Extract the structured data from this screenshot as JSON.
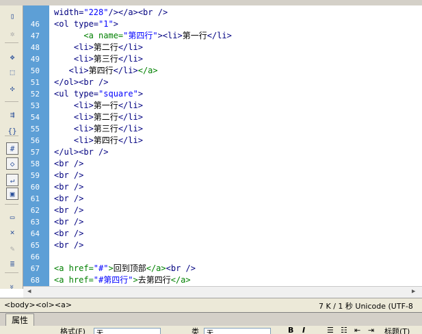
{
  "toolbar": {
    "icons": [
      "file-icon",
      "gear-icon",
      "expand-icon",
      "select-icon",
      "collapse-icon",
      "indent-icon",
      "braces-icon",
      "hash-icon",
      "code-icon",
      "wrap-icon",
      "highlight-icon",
      "comment-icon",
      "remove-comment-icon",
      "brush-icon",
      "format-icon",
      "more-icon"
    ]
  },
  "editor": {
    "lines": [
      {
        "n": "",
        "parts": [
          {
            "t": "width=",
            "c": "at"
          },
          {
            "t": "\"228\"",
            "c": "av"
          },
          {
            "t": "/></a><br />",
            "c": "kw"
          }
        ]
      },
      {
        "n": "46",
        "parts": [
          {
            "t": "<ol type=",
            "c": "kw"
          },
          {
            "t": "\"1\"",
            "c": "av"
          },
          {
            "t": ">",
            "c": "kw"
          }
        ]
      },
      {
        "n": "47",
        "parts": [
          {
            "t": "      <a name=",
            "c": "grn"
          },
          {
            "t": "\"第四行\"",
            "c": "av"
          },
          {
            "t": "><li>",
            "c": "kw"
          },
          {
            "t": "第一行",
            "c": "tx"
          },
          {
            "t": "</li>",
            "c": "kw"
          }
        ]
      },
      {
        "n": "48",
        "parts": [
          {
            "t": "    <li>",
            "c": "kw"
          },
          {
            "t": "第二行",
            "c": "tx"
          },
          {
            "t": "</li>",
            "c": "kw"
          }
        ]
      },
      {
        "n": "49",
        "parts": [
          {
            "t": "    <li>",
            "c": "kw"
          },
          {
            "t": "第三行",
            "c": "tx"
          },
          {
            "t": "</li>",
            "c": "kw"
          }
        ]
      },
      {
        "n": "50",
        "parts": [
          {
            "t": "   <li>",
            "c": "kw"
          },
          {
            "t": "第四行",
            "c": "tx"
          },
          {
            "t": "</li>",
            "c": "kw"
          },
          {
            "t": "</a>",
            "c": "grn"
          }
        ]
      },
      {
        "n": "51",
        "parts": [
          {
            "t": "</ol><br />",
            "c": "kw"
          }
        ]
      },
      {
        "n": "52",
        "parts": [
          {
            "t": "<ul type=",
            "c": "kw"
          },
          {
            "t": "\"square\"",
            "c": "av"
          },
          {
            "t": ">",
            "c": "kw"
          }
        ]
      },
      {
        "n": "53",
        "parts": [
          {
            "t": "    <li>",
            "c": "kw"
          },
          {
            "t": "第一行",
            "c": "tx"
          },
          {
            "t": "</li>",
            "c": "kw"
          }
        ]
      },
      {
        "n": "54",
        "parts": [
          {
            "t": "    <li>",
            "c": "kw"
          },
          {
            "t": "第二行",
            "c": "tx"
          },
          {
            "t": "</li>",
            "c": "kw"
          }
        ]
      },
      {
        "n": "55",
        "parts": [
          {
            "t": "    <li>",
            "c": "kw"
          },
          {
            "t": "第三行",
            "c": "tx"
          },
          {
            "t": "</li>",
            "c": "kw"
          }
        ]
      },
      {
        "n": "56",
        "parts": [
          {
            "t": "    <li>",
            "c": "kw"
          },
          {
            "t": "第四行",
            "c": "tx"
          },
          {
            "t": "</li>",
            "c": "kw"
          }
        ]
      },
      {
        "n": "57",
        "parts": [
          {
            "t": "</ul><br />",
            "c": "kw"
          }
        ]
      },
      {
        "n": "58",
        "parts": [
          {
            "t": "<br />",
            "c": "kw"
          }
        ]
      },
      {
        "n": "59",
        "parts": [
          {
            "t": "<br />",
            "c": "kw"
          }
        ]
      },
      {
        "n": "60",
        "parts": [
          {
            "t": "<br />",
            "c": "kw"
          }
        ]
      },
      {
        "n": "61",
        "parts": [
          {
            "t": "<br />",
            "c": "kw"
          }
        ]
      },
      {
        "n": "62",
        "parts": [
          {
            "t": "<br />",
            "c": "kw"
          }
        ]
      },
      {
        "n": "63",
        "parts": [
          {
            "t": "<br />",
            "c": "kw"
          }
        ]
      },
      {
        "n": "64",
        "parts": [
          {
            "t": "<br />",
            "c": "kw"
          }
        ]
      },
      {
        "n": "65",
        "parts": [
          {
            "t": "<br />",
            "c": "kw"
          }
        ]
      },
      {
        "n": "66",
        "parts": []
      },
      {
        "n": "67",
        "parts": [
          {
            "t": "<a href=",
            "c": "grn"
          },
          {
            "t": "\"#\"",
            "c": "av"
          },
          {
            "t": ">",
            "c": "grn"
          },
          {
            "t": "回到顶部",
            "c": "tx"
          },
          {
            "t": "</a>",
            "c": "grn"
          },
          {
            "t": "<br />",
            "c": "kw"
          }
        ]
      },
      {
        "n": "68",
        "parts": [
          {
            "t": "<a href=",
            "c": "grn"
          },
          {
            "t": "\"#第四行\"",
            "c": "av"
          },
          {
            "t": ">",
            "c": "grn"
          },
          {
            "t": "去第四行",
            "c": "tx"
          },
          {
            "t": "</a>",
            "c": "grn"
          }
        ]
      }
    ]
  },
  "statusbar": {
    "breadcrumb": "<body><ol><a>",
    "info": "7 K / 1 秒 Unicode (UTF-8"
  },
  "properties": {
    "title": "属性",
    "format_label": "格式(F)",
    "format_value": "无",
    "class_label": "类",
    "class_value": "无",
    "bold": "B",
    "italic": "I",
    "title_label": "标题(T)"
  }
}
